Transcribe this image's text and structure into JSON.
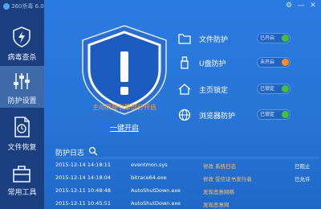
{
  "app": {
    "title": "360杀毒 6.0",
    "colors": {
      "sidebar": "#1b3f7e",
      "main": "#2a7be0",
      "warning": "#ff9a2e",
      "on": "#3fc23a",
      "off": "#ff8a1f"
    }
  },
  "window_controls": [
    "⚙",
    "—",
    "✕"
  ],
  "sidebar": {
    "items": [
      {
        "label": "病毒查杀",
        "icon": "lightning-shield-icon"
      },
      {
        "label": "防护设置",
        "icon": "sliders-icon",
        "active": true
      },
      {
        "label": "文件恢复",
        "icon": "file-restore-icon"
      },
      {
        "label": "常用工具",
        "icon": "toolbox-icon"
      }
    ]
  },
  "status": {
    "message": "主动防御引擎部分开启",
    "action_label": "一键开启",
    "shield_icon": "shield-exclamation-icon"
  },
  "protections": [
    {
      "label": "文件防护",
      "state": "已开启",
      "status": "on",
      "icon": "folder-icon"
    },
    {
      "label": "U盘防护",
      "state": "未开启",
      "status": "off",
      "icon": "usb-icon"
    },
    {
      "label": "主页锁定",
      "state": "已锁定",
      "status": "on",
      "icon": "home-icon"
    },
    {
      "label": "浏览器防护",
      "state": "已锁定",
      "status": "on",
      "icon": "globe-icon"
    }
  ],
  "log": {
    "title": "防护日志",
    "search_icon": "search-icon",
    "rows": [
      {
        "time": "2015-12-14 14:18:11",
        "process": "eventmon.sys",
        "action": "修改 系统日志",
        "result": "已阻止"
      },
      {
        "time": "2015-12-14 14:18:04",
        "process": "bitrace64.exe",
        "action": "修改 受信证书发行者",
        "result": "已允许"
      },
      {
        "time": "2015-12-11 10:48:48",
        "process": "AutoShutDown.exe",
        "action": "发现恶意网络",
        "result": ""
      },
      {
        "time": "2015-12-11 10:45:51",
        "process": "AutoShutDown.exe",
        "action": "发现恶意网",
        "result": ""
      }
    ]
  }
}
